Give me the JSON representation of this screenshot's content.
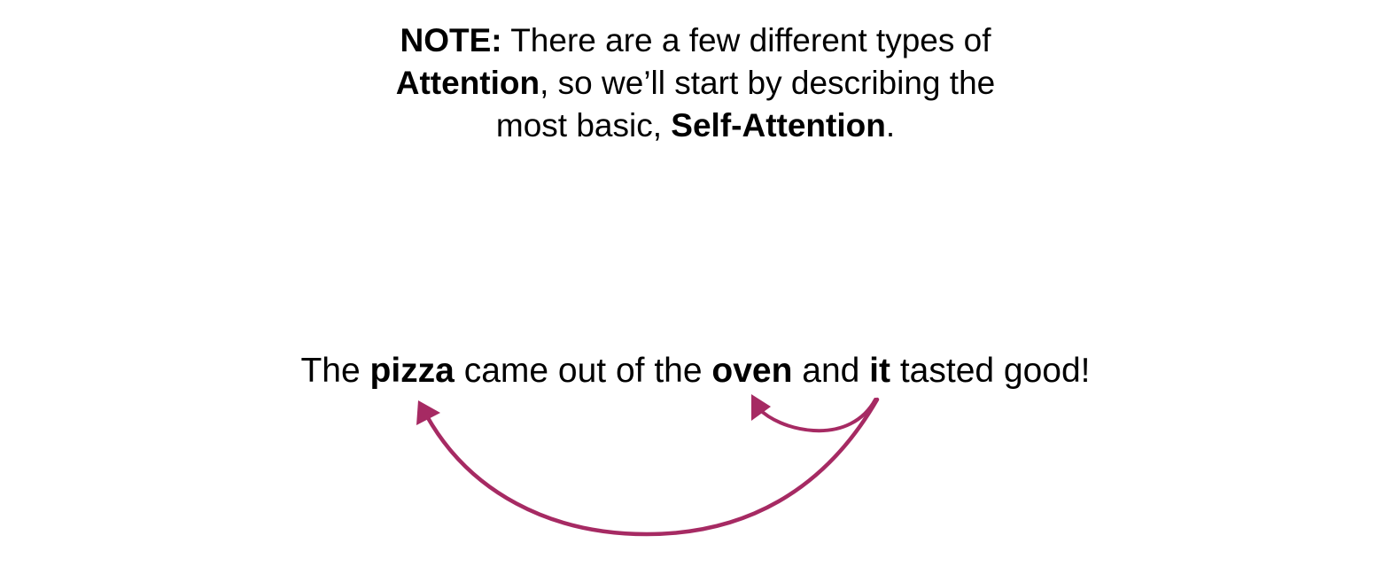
{
  "note": {
    "line1": {
      "bold_prefix": "NOTE:",
      "text": " There are a few different types of"
    },
    "line2": {
      "bold_word": "Attention",
      "text": ", so we’ll start by describing the"
    },
    "line3": {
      "text": "most basic, ",
      "bold_word": "Self-Attention",
      "suffix": "."
    }
  },
  "sentence": {
    "w1": "The ",
    "w2_bold": "pizza",
    "w3": " came out of the ",
    "w4_bold": "oven",
    "w5": " and ",
    "w6_bold": "it",
    "w7": " tasted good!"
  },
  "colors": {
    "arrow": "#a62a63",
    "text": "#000000",
    "background": "#ffffff"
  },
  "arrows": [
    {
      "from": "it",
      "to": "oven"
    },
    {
      "from": "it",
      "to": "pizza"
    }
  ]
}
